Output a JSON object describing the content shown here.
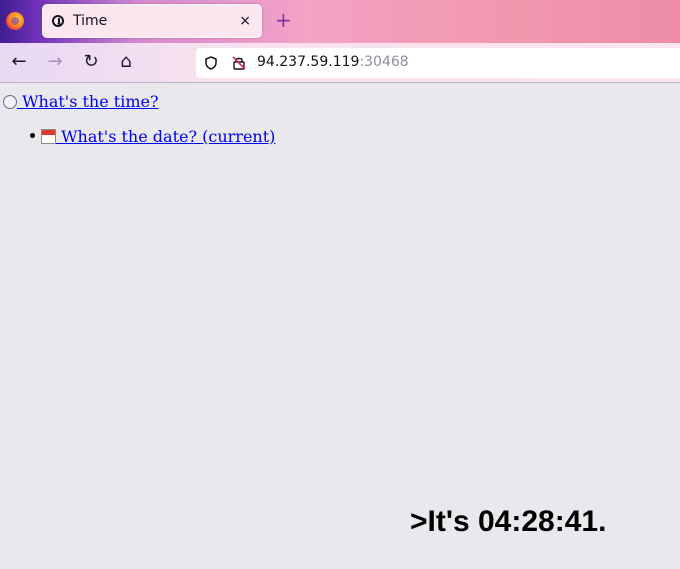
{
  "browser": {
    "tab": {
      "title": "Time",
      "close_glyph": "×",
      "icon": "clock-icon"
    },
    "new_tab_glyph": "+",
    "nav": {
      "back_glyph": "←",
      "forward_glyph": "→",
      "reload_glyph": "↻",
      "home_glyph": "⌂"
    },
    "url": {
      "host": "94.237.59.119",
      "port": ":30468"
    }
  },
  "page": {
    "time_link": " What's the time?",
    "date_link": " What's the date? (current)",
    "time_text": ">It's 04:28:41."
  },
  "colors": {
    "link": "#0000ee",
    "page_bg": "#e9e9ed"
  }
}
